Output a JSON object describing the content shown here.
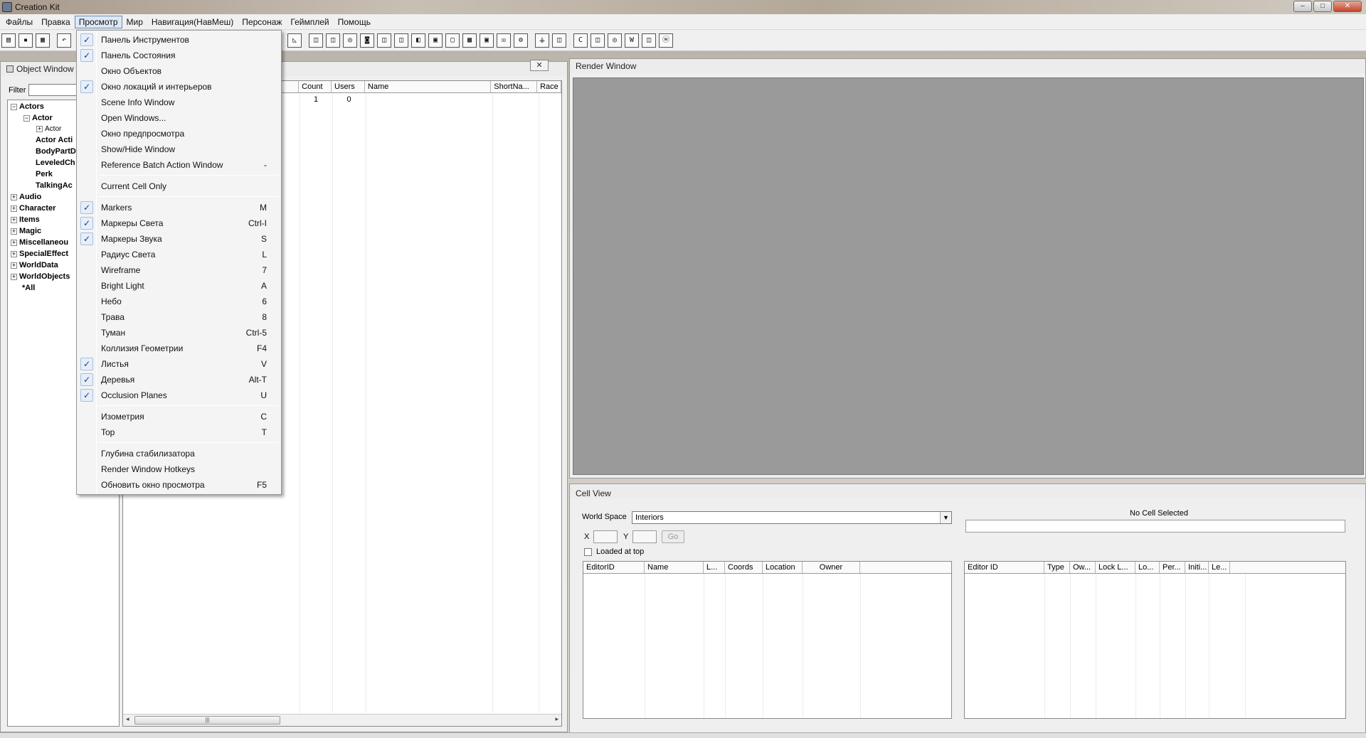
{
  "app": {
    "title": "Creation Kit"
  },
  "window_controls": {
    "minimize": "–",
    "maximize": "□",
    "close": "✕"
  },
  "menubar": {
    "items": [
      "Файлы",
      "Правка",
      "Просмотр",
      "Мир",
      "Навигация(НавМеш)",
      "Персонаж",
      "Геймплей",
      "Помощь"
    ]
  },
  "toolbar": {
    "icons": [
      "open-icon",
      "save-icon",
      "preferences-icon",
      "undo-icon"
    ],
    "letter_buttons": [
      "C",
      "W",
      "W"
    ]
  },
  "view_menu": {
    "items": [
      {
        "label": "Панель Инструментов",
        "checked": true,
        "shortcut": ""
      },
      {
        "label": "Панель Состояния",
        "checked": true,
        "shortcut": ""
      },
      {
        "label": "Окно Объектов",
        "checked": false,
        "shortcut": ""
      },
      {
        "label": "Окно локаций и интерьеров",
        "checked": true,
        "shortcut": ""
      },
      {
        "label": "Scene Info Window",
        "checked": false,
        "shortcut": ""
      },
      {
        "label": "Open Windows...",
        "checked": false,
        "shortcut": ""
      },
      {
        "label": "Окно предпросмотра",
        "checked": false,
        "shortcut": ""
      },
      {
        "label": "Show/Hide Window",
        "checked": false,
        "shortcut": ""
      },
      {
        "label": "Reference Batch Action Window",
        "checked": false,
        "shortcut": "-"
      },
      {
        "label": "Current Cell Only",
        "checked": false,
        "shortcut": ""
      },
      {
        "label": "Markers",
        "checked": true,
        "shortcut": "M"
      },
      {
        "label": "Маркеры Света",
        "checked": true,
        "shortcut": "Ctrl-I"
      },
      {
        "label": "Маркеры Звука",
        "checked": true,
        "shortcut": "S"
      },
      {
        "label": "Радиус Света",
        "checked": false,
        "shortcut": "L"
      },
      {
        "label": "Wireframe",
        "checked": false,
        "shortcut": "7"
      },
      {
        "label": "Bright Light",
        "checked": false,
        "shortcut": "A"
      },
      {
        "label": "Небо",
        "checked": false,
        "shortcut": "6"
      },
      {
        "label": "Трава",
        "checked": false,
        "shortcut": "8"
      },
      {
        "label": "Туман",
        "checked": false,
        "shortcut": "Ctrl-5"
      },
      {
        "label": "Коллизия Геометрии",
        "checked": false,
        "shortcut": "F4"
      },
      {
        "label": "Листья",
        "checked": true,
        "shortcut": "V"
      },
      {
        "label": "Деревья",
        "checked": true,
        "shortcut": "Alt-T"
      },
      {
        "label": "Occlusion Planes",
        "checked": true,
        "shortcut": "U"
      },
      {
        "label": "Изометрия",
        "checked": false,
        "shortcut": "C"
      },
      {
        "label": "Top",
        "checked": false,
        "shortcut": "T"
      },
      {
        "label": "Глубина стабилизатора",
        "checked": false,
        "shortcut": ""
      },
      {
        "label": "Render Window Hotkeys",
        "checked": false,
        "shortcut": ""
      },
      {
        "label": "Обновить окно просмотра",
        "checked": false,
        "shortcut": "F5"
      }
    ],
    "check_glyph": "✓"
  },
  "object_window": {
    "title": "Object Window",
    "close": "✕",
    "filter_label": "Filter",
    "filter_value": "",
    "tree": [
      {
        "label": "Actors",
        "expander": "−",
        "bold": true
      },
      {
        "label": "Actor",
        "expander": "−",
        "bold": true
      },
      {
        "label": "Actor",
        "expander": "+",
        "bold": false
      },
      {
        "label": "Actor Acti",
        "expander": "",
        "bold": true
      },
      {
        "label": "BodyPartD",
        "expander": "",
        "bold": true
      },
      {
        "label": "LeveledCh",
        "expander": "",
        "bold": true
      },
      {
        "label": "Perk",
        "expander": "",
        "bold": true
      },
      {
        "label": "TalkingAc",
        "expander": "",
        "bold": true
      },
      {
        "label": "Audio",
        "expander": "+",
        "bold": true
      },
      {
        "label": "Character",
        "expander": "+",
        "bold": true
      },
      {
        "label": "Items",
        "expander": "+",
        "bold": true
      },
      {
        "label": "Magic",
        "expander": "+",
        "bold": true
      },
      {
        "label": "Miscellaneou",
        "expander": "+",
        "bold": true
      },
      {
        "label": "SpecialEffect",
        "expander": "+",
        "bold": true
      },
      {
        "label": "WorldData",
        "expander": "+",
        "bold": true
      },
      {
        "label": "WorldObjects",
        "expander": "+",
        "bold": true
      },
      {
        "label": "*All",
        "expander": "",
        "bold": true
      }
    ],
    "columns": [
      "Count",
      "Users",
      "Name",
      "ShortNa...",
      "Race"
    ],
    "rows": [
      {
        "count": "1",
        "users": "0",
        "name": "",
        "short": "",
        "race": ""
      }
    ],
    "scroll_thumb": "|||",
    "scroll_left": "◂",
    "scroll_right": "▸"
  },
  "render_window": {
    "title": "Render Window"
  },
  "cell_view": {
    "title": "Cell View",
    "world_space_label": "World Space",
    "world_space_value": "Interiors",
    "dropdown_arrow": "▼",
    "x_label": "X",
    "y_label": "Y",
    "go_label": "Go",
    "loaded_at_top_label": "Loaded at top",
    "loaded_at_top_checked": false,
    "status_text": "No Cell Selected",
    "left_columns": [
      "EditorID",
      "Name",
      "L...",
      "Coords",
      "Location",
      "Owner"
    ],
    "right_columns": [
      "Editor ID",
      "Type",
      "Ow...",
      "Lock L...",
      "Lo...",
      "Per...",
      "Initi...",
      "Le..."
    ]
  }
}
